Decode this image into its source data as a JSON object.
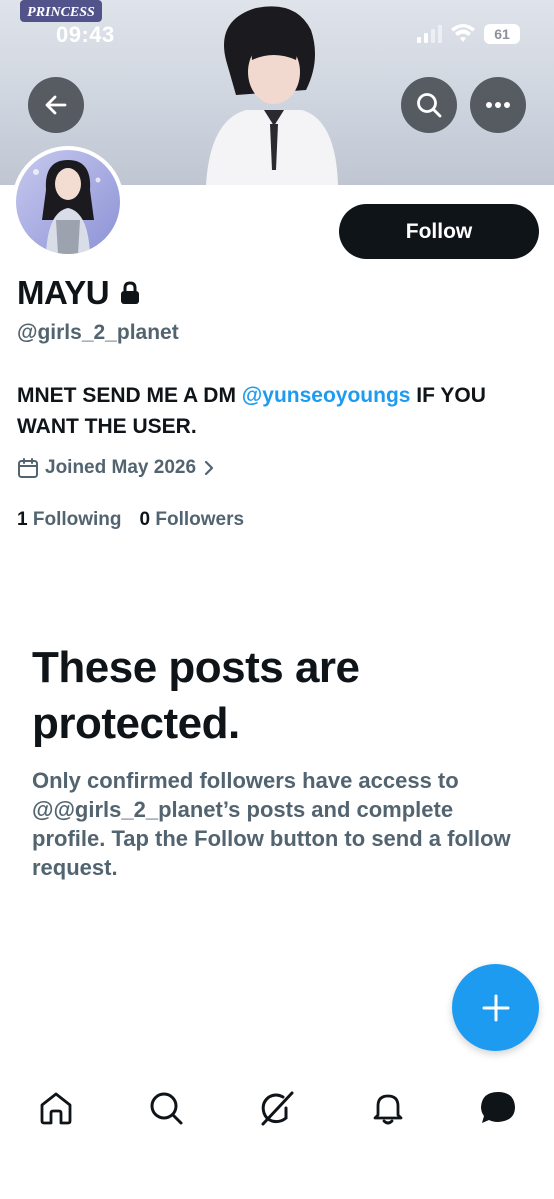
{
  "status_bar": {
    "time": "09:43",
    "battery": "61"
  },
  "banner": {
    "logo_text": "PRINCESS"
  },
  "profile": {
    "name": "MAYU",
    "handle": "@girls_2_planet",
    "bio_prefix": "MNET SEND ME A DM ",
    "bio_mention": "@yunseoyoungs",
    "bio_suffix": " IF YOU WANT THE USER.",
    "joined": "Joined May 2026",
    "following_count": "1",
    "following_label": "Following",
    "followers_count": "0",
    "followers_label": "Followers",
    "follow_button": "Follow"
  },
  "protected": {
    "title": "These posts are protected.",
    "description": "Only confirmed followers have access to @@girls_2_planet’s posts and complete profile. Tap the Follow button to send a follow request."
  },
  "icons": [
    "back-arrow-icon",
    "search-icon",
    "more-icon",
    "lock-icon",
    "calendar-icon",
    "chevron-right-icon",
    "plus-icon",
    "home-icon",
    "grok-icon",
    "bell-icon",
    "messages-icon"
  ],
  "colors": {
    "accent": "#1d9bf0",
    "text": "#0f1419",
    "secondary": "#536471"
  }
}
